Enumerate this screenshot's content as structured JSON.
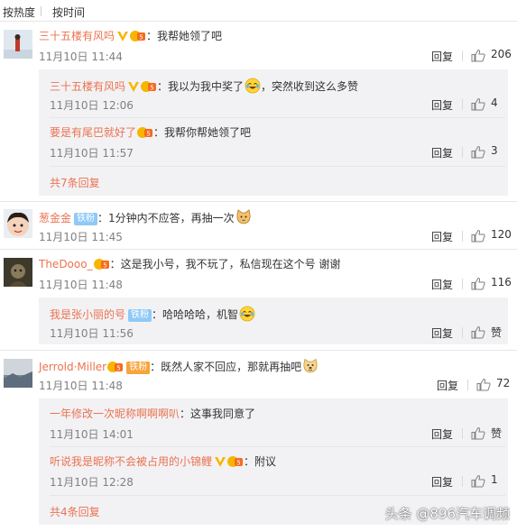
{
  "sort_tabs": {
    "hot": "按热度",
    "time": "按时间"
  },
  "reply_label": "回复",
  "comments": [
    {
      "user": "三十五楼有风吗",
      "text": "：我帮她领了吧",
      "time": "11月10日 11:44",
      "likes": "206"
    },
    {
      "user": "葱金金",
      "text": "：1分钟内不应答，再抽一次",
      "time": "11月10日 11:45",
      "likes": "120",
      "fan_label": "铁粉"
    },
    {
      "user": "TheDooo_",
      "text": "：这是我小号，我不玩了，私信现在这个号 谢谢",
      "time": "11月10日 11:48",
      "likes": "116"
    },
    {
      "user": "Jerrold·Miller",
      "text": "：既然人家不回应，那就再抽吧",
      "time": "11月10日 11:48",
      "likes": "72",
      "fan_label": "铁粉"
    }
  ],
  "sub_replies": [
    {
      "user": "三十五楼有风吗",
      "text": "：我以为我中奖了",
      "text2": "，突然收到这么多赞",
      "time": "11月10日 12:06",
      "likes": "4"
    },
    {
      "user": "要是有尾巴就好了",
      "text": "：我帮你帮她领了吧",
      "time": "11月10日 11:57",
      "likes": "3"
    },
    {
      "user": "我是张小丽的号",
      "text": "：哈哈哈哈，机智",
      "time": "11月10日 11:56",
      "likes": "赞",
      "fan_label": "铁粉"
    },
    {
      "user": "一年修改一次昵称啊啊啊叭",
      "text": "：这事我同意了",
      "time": "11月10日 14:01",
      "likes": "赞"
    },
    {
      "user": "听说我是昵称不会被占用的小锦鲤",
      "text": "：附议",
      "time": "11月10日 12:28",
      "likes": "1"
    }
  ],
  "more_replies": [
    "共7条回复",
    "共4条回复"
  ],
  "watermark": "头条 @896汽车调频",
  "colors": {
    "name": "#eb7350",
    "subbox": "#f2f2f5",
    "vip": "#f7b500"
  },
  "icons": [
    "thumb-up-icon",
    "vip-v-icon",
    "member-badge-icon",
    "laugh-cry-emoji",
    "cat-emoji",
    "doge-emoji"
  ]
}
